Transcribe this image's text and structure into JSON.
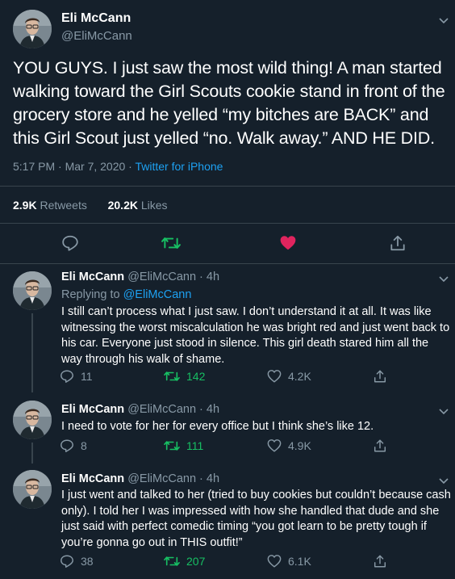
{
  "main": {
    "name": "Eli McCann",
    "handle": "@EliMcCann",
    "text": "YOU GUYS. I just saw the most wild thing! A man started walking toward the Girl Scouts cookie stand in front of the grocery store and he yelled “my bitches are BACK” and this Girl Scout just yelled “no. Walk away.” AND HE DID.",
    "time": "5:17 PM · Mar 7, 2020 · ",
    "source": "Twitter for iPhone",
    "retweets_count": "2.9K",
    "retweets_label": "Retweets",
    "likes_count": "20.2K",
    "likes_label": "Likes"
  },
  "replies": [
    {
      "name": "Eli McCann",
      "handle": "@EliMcCann · 4h",
      "replying_prefix": "Replying to ",
      "replying_to": "@EliMcCann",
      "text": "I still can’t process what I just saw. I don’t understand it at all. It was like witnessing the worst miscalculation he was bright red and just went back to his car. Everyone just stood in silence. This girl death stared him all the way through his walk of shame.",
      "replies": "11",
      "retweets": "142",
      "likes": "4.2K"
    },
    {
      "name": "Eli McCann",
      "handle": "@EliMcCann · 4h",
      "text": "I need to vote for her for every office but I think she’s like 12.",
      "replies": "8",
      "retweets": "111",
      "likes": "4.9K"
    },
    {
      "name": "Eli McCann",
      "handle": "@EliMcCann · 4h",
      "text": "I just went and talked to her (tried to buy cookies but couldn’t because cash only). I told her I was impressed with how she handled that dude and she just said with perfect comedic timing “you got learn to be pretty tough if you’re gonna go out in THIS outfit!”",
      "replies": "38",
      "retweets": "207",
      "likes": "6.1K"
    }
  ],
  "colors": {
    "background": "#15202b",
    "muted": "#8899a6",
    "link": "#1da1f2",
    "retweet": "#17bf63",
    "like": "#e0245e",
    "divider": "#38444d"
  },
  "icons": [
    "chevron-down-icon",
    "reply-icon",
    "retweet-icon",
    "heart-icon",
    "share-icon"
  ]
}
